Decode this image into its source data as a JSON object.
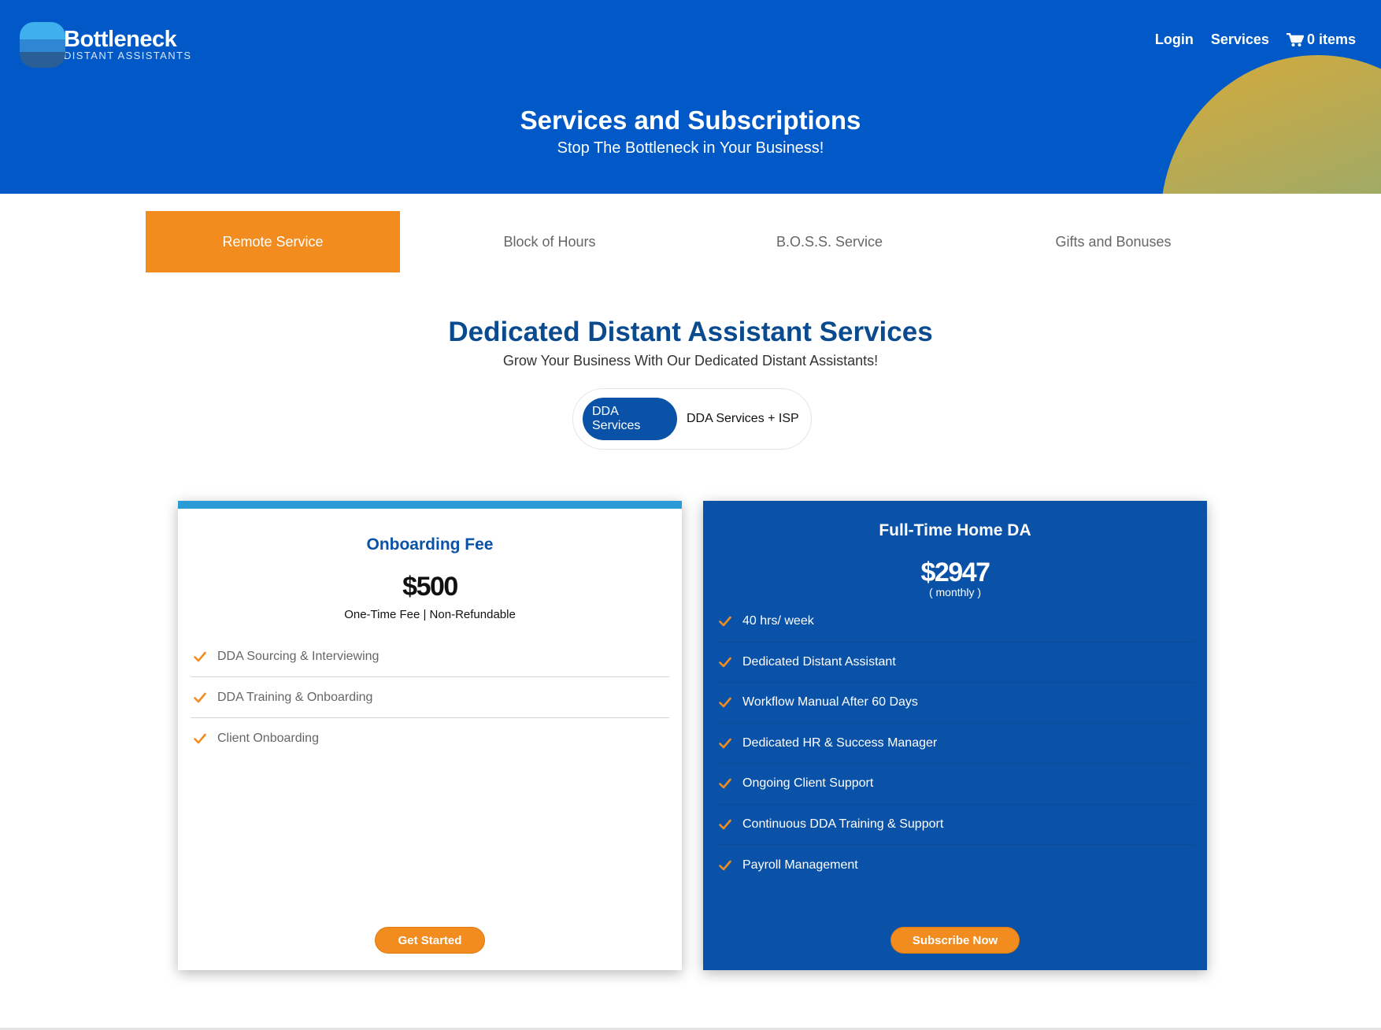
{
  "brand": {
    "name": "Bottleneck",
    "tagline": "DISTANT ASSISTANTS"
  },
  "nav": {
    "login": "Login",
    "services": "Services",
    "cart": "0 items"
  },
  "hero": {
    "title": "Services and Subscriptions",
    "subtitle": "Stop The Bottleneck in Your Business!"
  },
  "tabs": [
    {
      "label": "Remote Service",
      "active": true
    },
    {
      "label": "Block of Hours",
      "active": false
    },
    {
      "label": "B.O.S.S. Service",
      "active": false
    },
    {
      "label": "Gifts and Bonuses",
      "active": false
    }
  ],
  "section": {
    "title": "Dedicated Distant Assistant Services",
    "subtitle": "Grow Your Business With Our Dedicated Distant Assistants!"
  },
  "toggle": {
    "selected": "DDA Services",
    "options": [
      "DDA Services",
      "DDA Services + ISP"
    ]
  },
  "plans": [
    {
      "title": "Onboarding Fee",
      "price": "$500",
      "note": "One-Time Fee | Non-Refundable",
      "features": [
        "DDA Sourcing & Interviewing",
        "DDA Training & Onboarding",
        "Client Onboarding"
      ],
      "button": "Get Started"
    },
    {
      "title": "Full-Time Home DA",
      "price": "$2947",
      "note": "( monthly )",
      "features": [
        "40 hrs/ week",
        "Dedicated Distant Assistant",
        "Workflow Manual After 60 Days",
        "Dedicated HR & Success Manager",
        "Ongoing Client Support",
        "Continuous DDA Training & Support",
        "Payroll Management"
      ],
      "button": "Subscribe Now"
    }
  ],
  "colors": {
    "header": "#0059c6",
    "accent": "#f28c1f",
    "navy": "#0a52a8",
    "titleBlue": "#0a4a8f",
    "cardTop": "#2a9bd6"
  },
  "icons": {
    "cart": "cart-icon",
    "check": "check-icon"
  }
}
